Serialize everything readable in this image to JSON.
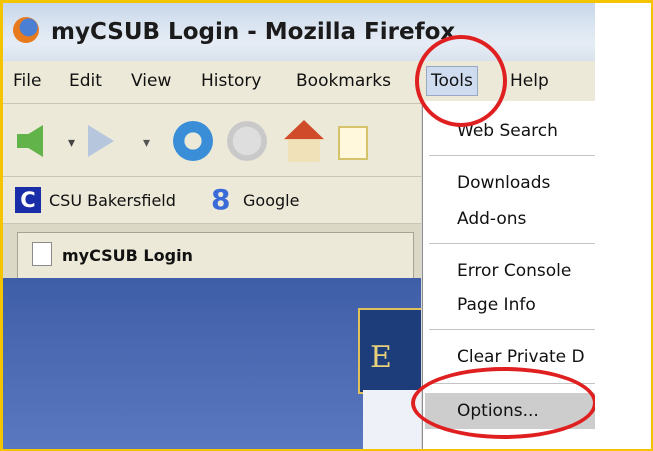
{
  "window": {
    "title": "myCSUB Login - Mozilla Firefox"
  },
  "menubar": {
    "items": [
      "File",
      "Edit",
      "View",
      "History",
      "Bookmarks",
      "Tools",
      "Help"
    ],
    "active": "Tools"
  },
  "bookmarks": {
    "items": [
      {
        "label": "CSU Bakersfield",
        "icon": "C"
      },
      {
        "label": "Google",
        "icon": "8"
      }
    ]
  },
  "tab": {
    "label": "myCSUB Login"
  },
  "tools_menu": {
    "items": [
      "Web Search",
      "Downloads",
      "Add-ons",
      "Error Console",
      "Page Info",
      "Clear Private D",
      "Options..."
    ],
    "highlighted": "Options..."
  },
  "colors": {
    "highlight": "#e02020",
    "accent": "#f5c400"
  }
}
